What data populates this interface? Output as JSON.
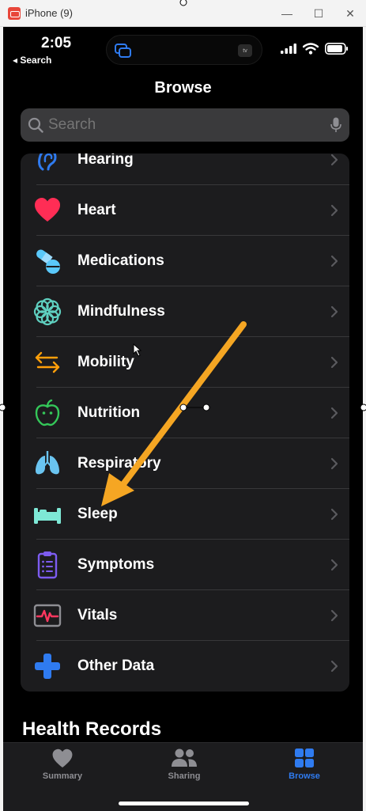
{
  "window": {
    "title": "iPhone (9)",
    "minimize": "—",
    "maximize": "☐",
    "close": "✕"
  },
  "status": {
    "time": "2:05",
    "back": "◂ Search",
    "island_badge": "tv"
  },
  "page": {
    "title": "Browse"
  },
  "search": {
    "placeholder": "Search"
  },
  "categories": [
    {
      "label": "Hearing",
      "icon": "ear-icon",
      "color": "#2f7bf0"
    },
    {
      "label": "Heart",
      "icon": "heart-icon",
      "color": "#ff2d55"
    },
    {
      "label": "Medications",
      "icon": "pills-icon",
      "color": "#5ac8fa"
    },
    {
      "label": "Mindfulness",
      "icon": "flower-icon",
      "color": "#5fd0c0"
    },
    {
      "label": "Mobility",
      "icon": "arrows-icon",
      "color": "#ff9f0a"
    },
    {
      "label": "Nutrition",
      "icon": "apple-icon",
      "color": "#34c759"
    },
    {
      "label": "Respiratory",
      "icon": "lungs-icon",
      "color": "#6ac4f0"
    },
    {
      "label": "Sleep",
      "icon": "bed-icon",
      "color": "#7ee8d6"
    },
    {
      "label": "Symptoms",
      "icon": "clipboard-icon",
      "color": "#7d5cf0"
    },
    {
      "label": "Vitals",
      "icon": "vitals-icon",
      "color": "#ff375f"
    },
    {
      "label": "Other Data",
      "icon": "plus-icon",
      "color": "#2f7bf0"
    }
  ],
  "section": {
    "health_records": "Health Records"
  },
  "tabs": [
    {
      "label": "Summary",
      "icon": "heart-icon",
      "active": false
    },
    {
      "label": "Sharing",
      "icon": "people-icon",
      "active": false
    },
    {
      "label": "Browse",
      "icon": "grid-icon",
      "active": true
    }
  ],
  "annotation": {
    "arrow_color": "#f5a623"
  }
}
